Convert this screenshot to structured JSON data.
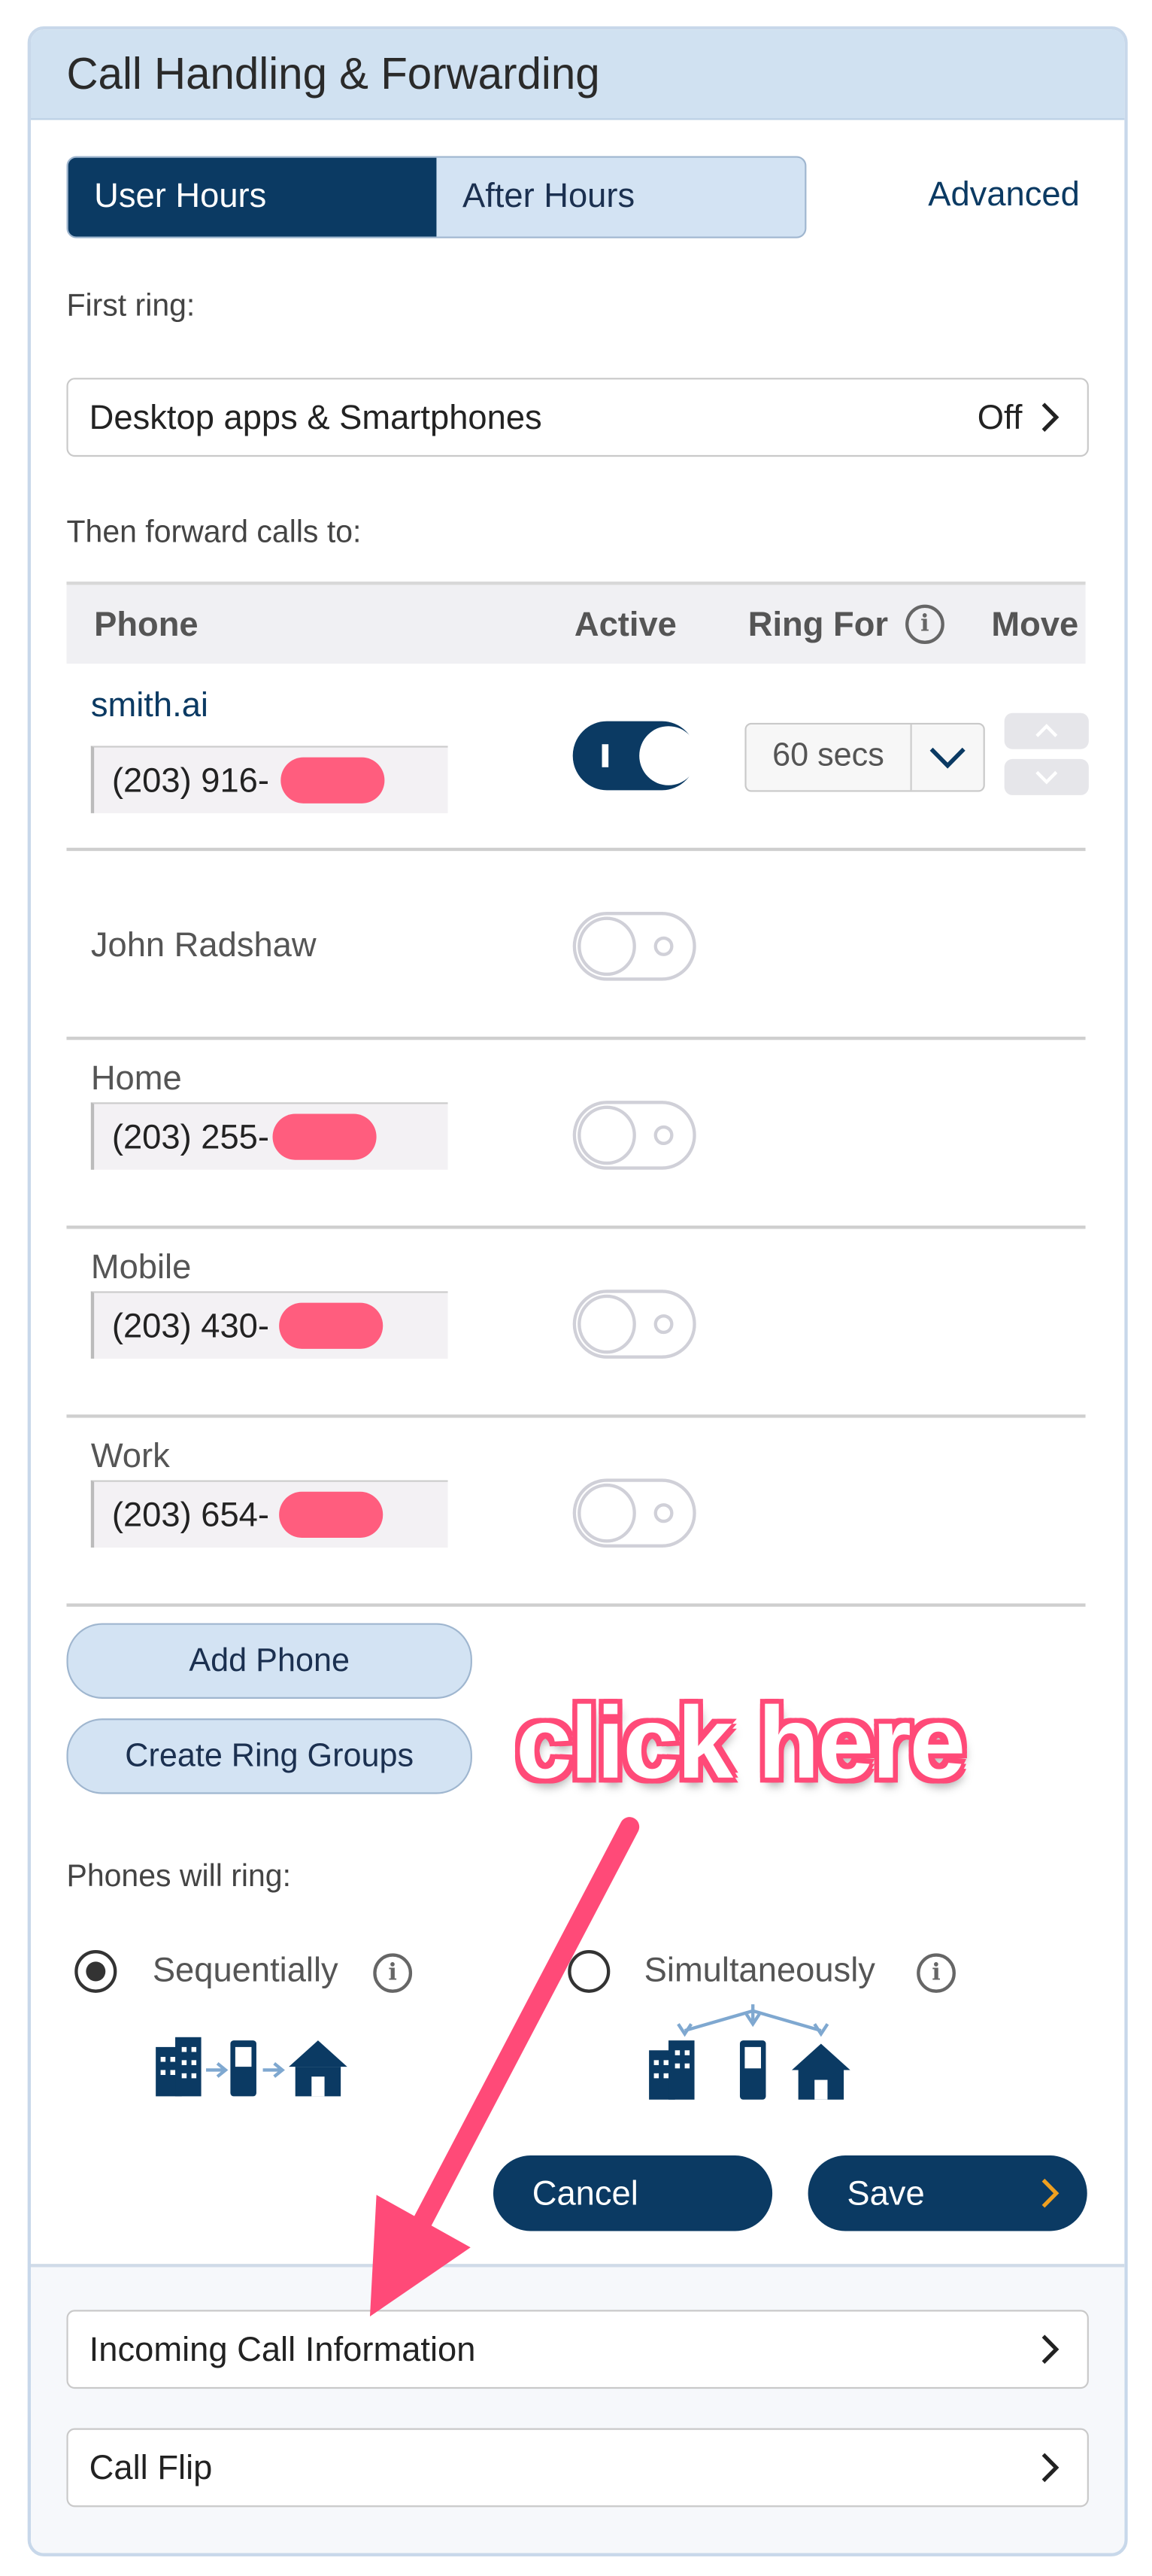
{
  "panel": {
    "title": "Call Handling & Forwarding",
    "tabs": [
      {
        "label": "User Hours",
        "active": true
      },
      {
        "label": "After Hours",
        "active": false
      }
    ],
    "advanced_link": "Advanced",
    "first_ring_label": "First ring:",
    "first_ring_option": {
      "label": "Desktop apps & Smartphones",
      "value": "Off"
    },
    "forward_label": "Then forward calls to:",
    "table_headers": {
      "phone": "Phone",
      "active": "Active",
      "ring_for": "Ring For",
      "move": "Move"
    },
    "phones": [
      {
        "name": "smith.ai",
        "number": "(203) 916-",
        "active": true,
        "ring_for": "60 secs"
      },
      {
        "name": "John Radshaw",
        "number": "",
        "active": false
      },
      {
        "name": "Home",
        "number": "(203) 255-",
        "active": false
      },
      {
        "name": "Mobile",
        "number": "(203) 430-",
        "active": false
      },
      {
        "name": "Work",
        "number": "(203) 654-",
        "active": false
      }
    ],
    "add_phone_button": "Add Phone",
    "ring_groups_button": "Create Ring Groups",
    "ring_mode_label": "Phones will ring:",
    "ring_modes": [
      {
        "label": "Sequentially",
        "selected": true
      },
      {
        "label": "Simultaneously",
        "selected": false
      }
    ],
    "cancel_button": "Cancel",
    "save_button": "Save",
    "footer_items": [
      "Incoming Call Information",
      "Call Flip"
    ]
  },
  "annotation": {
    "text": "click here",
    "color": "#ff4a78"
  },
  "colors": {
    "primary": "#0b3a63",
    "header_bg": "#d0e1f1",
    "tab_light": "#d3e3f3",
    "save_chevron": "#f0a020"
  }
}
